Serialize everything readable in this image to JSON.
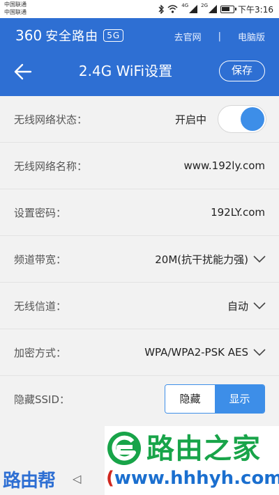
{
  "statusbar": {
    "carrier1": "中国联通",
    "carrier2": "中国联通",
    "signal1_tag": "4G",
    "signal2_tag": "2G",
    "time": "下午3:16",
    "battery_level": 0.75
  },
  "header": {
    "brand_num": "360",
    "brand_text": "安全路由",
    "brand_badge": "5G",
    "link_official": "去官网",
    "separator": "|",
    "link_pc": "电脑版",
    "title": "2.4G WiFi设置",
    "save_label": "保存"
  },
  "settings": {
    "wifi_status": {
      "label": "无线网络状态：",
      "value": "开启中",
      "enabled": true
    },
    "ssid": {
      "label": "无线网络名称：",
      "value": "www.192ly.com"
    },
    "password": {
      "label": "设置密码：",
      "value": "192LY.com"
    },
    "bandwidth": {
      "label": "频道带宽：",
      "value": "20M(抗干扰能力强)"
    },
    "channel": {
      "label": "无线信道：",
      "value": "自动"
    },
    "encryption": {
      "label": "加密方式：",
      "value": "WPA/WPA2-PSK AES"
    },
    "hide_ssid": {
      "label": "隐藏SSID：",
      "option_hide": "隐藏",
      "option_show": "显示",
      "selected": "显示"
    }
  },
  "watermark": {
    "title": "路由之家",
    "url": "www.hhhyh.com",
    "paren_open": "(",
    "helper": "路由帮",
    "nav_back": "◁"
  },
  "colors": {
    "header_bg": "#2e6fd3",
    "accent": "#3d8ee8",
    "watermark_green": "#18a449"
  }
}
